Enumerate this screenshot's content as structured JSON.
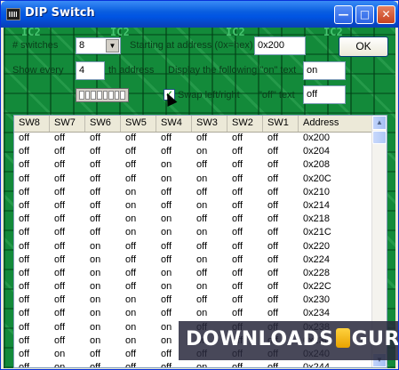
{
  "window": {
    "title": "DIP Switch"
  },
  "form": {
    "switches_label": "# switches",
    "switches_value": "8",
    "address_label": "Starting at address (0x=hex)",
    "address_value": "0x200",
    "ok_label": "OK",
    "show_every_label": "Show every",
    "show_every_value": "4",
    "nth_address_label": "th address",
    "display_on_label": "Display the following \"on\" text",
    "on_text_value": "on",
    "swap_label": "Swap left/right",
    "off_text_label": "\"off\" text",
    "off_text_value": "off"
  },
  "table": {
    "columns": [
      "SW8",
      "SW7",
      "SW6",
      "SW5",
      "SW4",
      "SW3",
      "SW2",
      "SW1",
      "Address"
    ],
    "rows": [
      [
        "off",
        "off",
        "off",
        "off",
        "off",
        "off",
        "off",
        "off",
        "0x200"
      ],
      [
        "off",
        "off",
        "off",
        "off",
        "off",
        "on",
        "off",
        "off",
        "0x204"
      ],
      [
        "off",
        "off",
        "off",
        "off",
        "on",
        "off",
        "off",
        "off",
        "0x208"
      ],
      [
        "off",
        "off",
        "off",
        "off",
        "on",
        "on",
        "off",
        "off",
        "0x20C"
      ],
      [
        "off",
        "off",
        "off",
        "on",
        "off",
        "off",
        "off",
        "off",
        "0x210"
      ],
      [
        "off",
        "off",
        "off",
        "on",
        "off",
        "on",
        "off",
        "off",
        "0x214"
      ],
      [
        "off",
        "off",
        "off",
        "on",
        "on",
        "off",
        "off",
        "off",
        "0x218"
      ],
      [
        "off",
        "off",
        "off",
        "on",
        "on",
        "on",
        "off",
        "off",
        "0x21C"
      ],
      [
        "off",
        "off",
        "on",
        "off",
        "off",
        "off",
        "off",
        "off",
        "0x220"
      ],
      [
        "off",
        "off",
        "on",
        "off",
        "off",
        "on",
        "off",
        "off",
        "0x224"
      ],
      [
        "off",
        "off",
        "on",
        "off",
        "on",
        "off",
        "off",
        "off",
        "0x228"
      ],
      [
        "off",
        "off",
        "on",
        "off",
        "on",
        "on",
        "off",
        "off",
        "0x22C"
      ],
      [
        "off",
        "off",
        "on",
        "on",
        "off",
        "off",
        "off",
        "off",
        "0x230"
      ],
      [
        "off",
        "off",
        "on",
        "on",
        "off",
        "on",
        "off",
        "off",
        "0x234"
      ],
      [
        "off",
        "off",
        "on",
        "on",
        "on",
        "off",
        "off",
        "off",
        "0x238"
      ],
      [
        "off",
        "off",
        "on",
        "on",
        "on",
        "on",
        "off",
        "off",
        "0x23C"
      ],
      [
        "off",
        "on",
        "off",
        "off",
        "off",
        "off",
        "off",
        "off",
        "0x240"
      ],
      [
        "off",
        "on",
        "off",
        "off",
        "off",
        "on",
        "off",
        "off",
        "0x244"
      ]
    ]
  },
  "watermark": {
    "left": "DOWNLOADS",
    "right": "GURU"
  }
}
